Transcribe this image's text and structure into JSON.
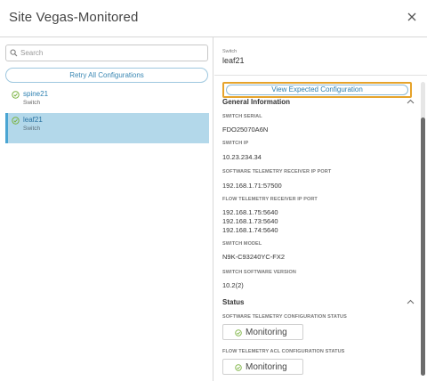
{
  "window": {
    "title": "Site Vegas-Monitored"
  },
  "left_panel": {
    "search_placeholder": "Search",
    "retry_label": "Retry All Configurations",
    "items": [
      {
        "name": "spine21",
        "sub": "Switch",
        "status_icon": "check-circle-icon",
        "selected": false
      },
      {
        "name": "leaf21",
        "sub": "Switch",
        "status_icon": "check-circle-icon",
        "selected": true
      }
    ]
  },
  "right_panel": {
    "switch_label": "Switch",
    "switch_name": "leaf21",
    "view_button_label": "View Expected Configuration",
    "general": {
      "title": "General Information",
      "fields": [
        {
          "label": "SWITCH SERIAL",
          "value": [
            "FDO25070A6N"
          ]
        },
        {
          "label": "SWITCH IP",
          "value": [
            "10.23.234.34"
          ]
        },
        {
          "label": "SOFTWARE TELEMETRY RECEIVER IP PORT",
          "value": [
            "192.168.1.71:57500"
          ]
        },
        {
          "label": "FLOW TELEMETRY RECEIVER IP PORT",
          "value": [
            "192.168.1.75:5640",
            "192.168.1.73:5640",
            "192.168.1.74:5640"
          ]
        },
        {
          "label": "SWITCH MODEL",
          "value": [
            "N9K-C93240YC-FX2"
          ]
        },
        {
          "label": "SWITCH SOFTWARE VERSION",
          "value": [
            "10.2(2)"
          ]
        }
      ]
    },
    "status": {
      "title": "Status",
      "items": [
        {
          "label": "SOFTWARE TELEMETRY CONFIGURATION STATUS",
          "value": "Monitoring"
        },
        {
          "label": "FLOW TELEMETRY ACL CONFIGURATION STATUS",
          "value": "Monitoring"
        }
      ]
    }
  },
  "colors": {
    "accent": "#2c7fb0",
    "selected_bg": "#b3d8ea",
    "highlight_border": "#e6a32b",
    "success": "#7cb342"
  }
}
